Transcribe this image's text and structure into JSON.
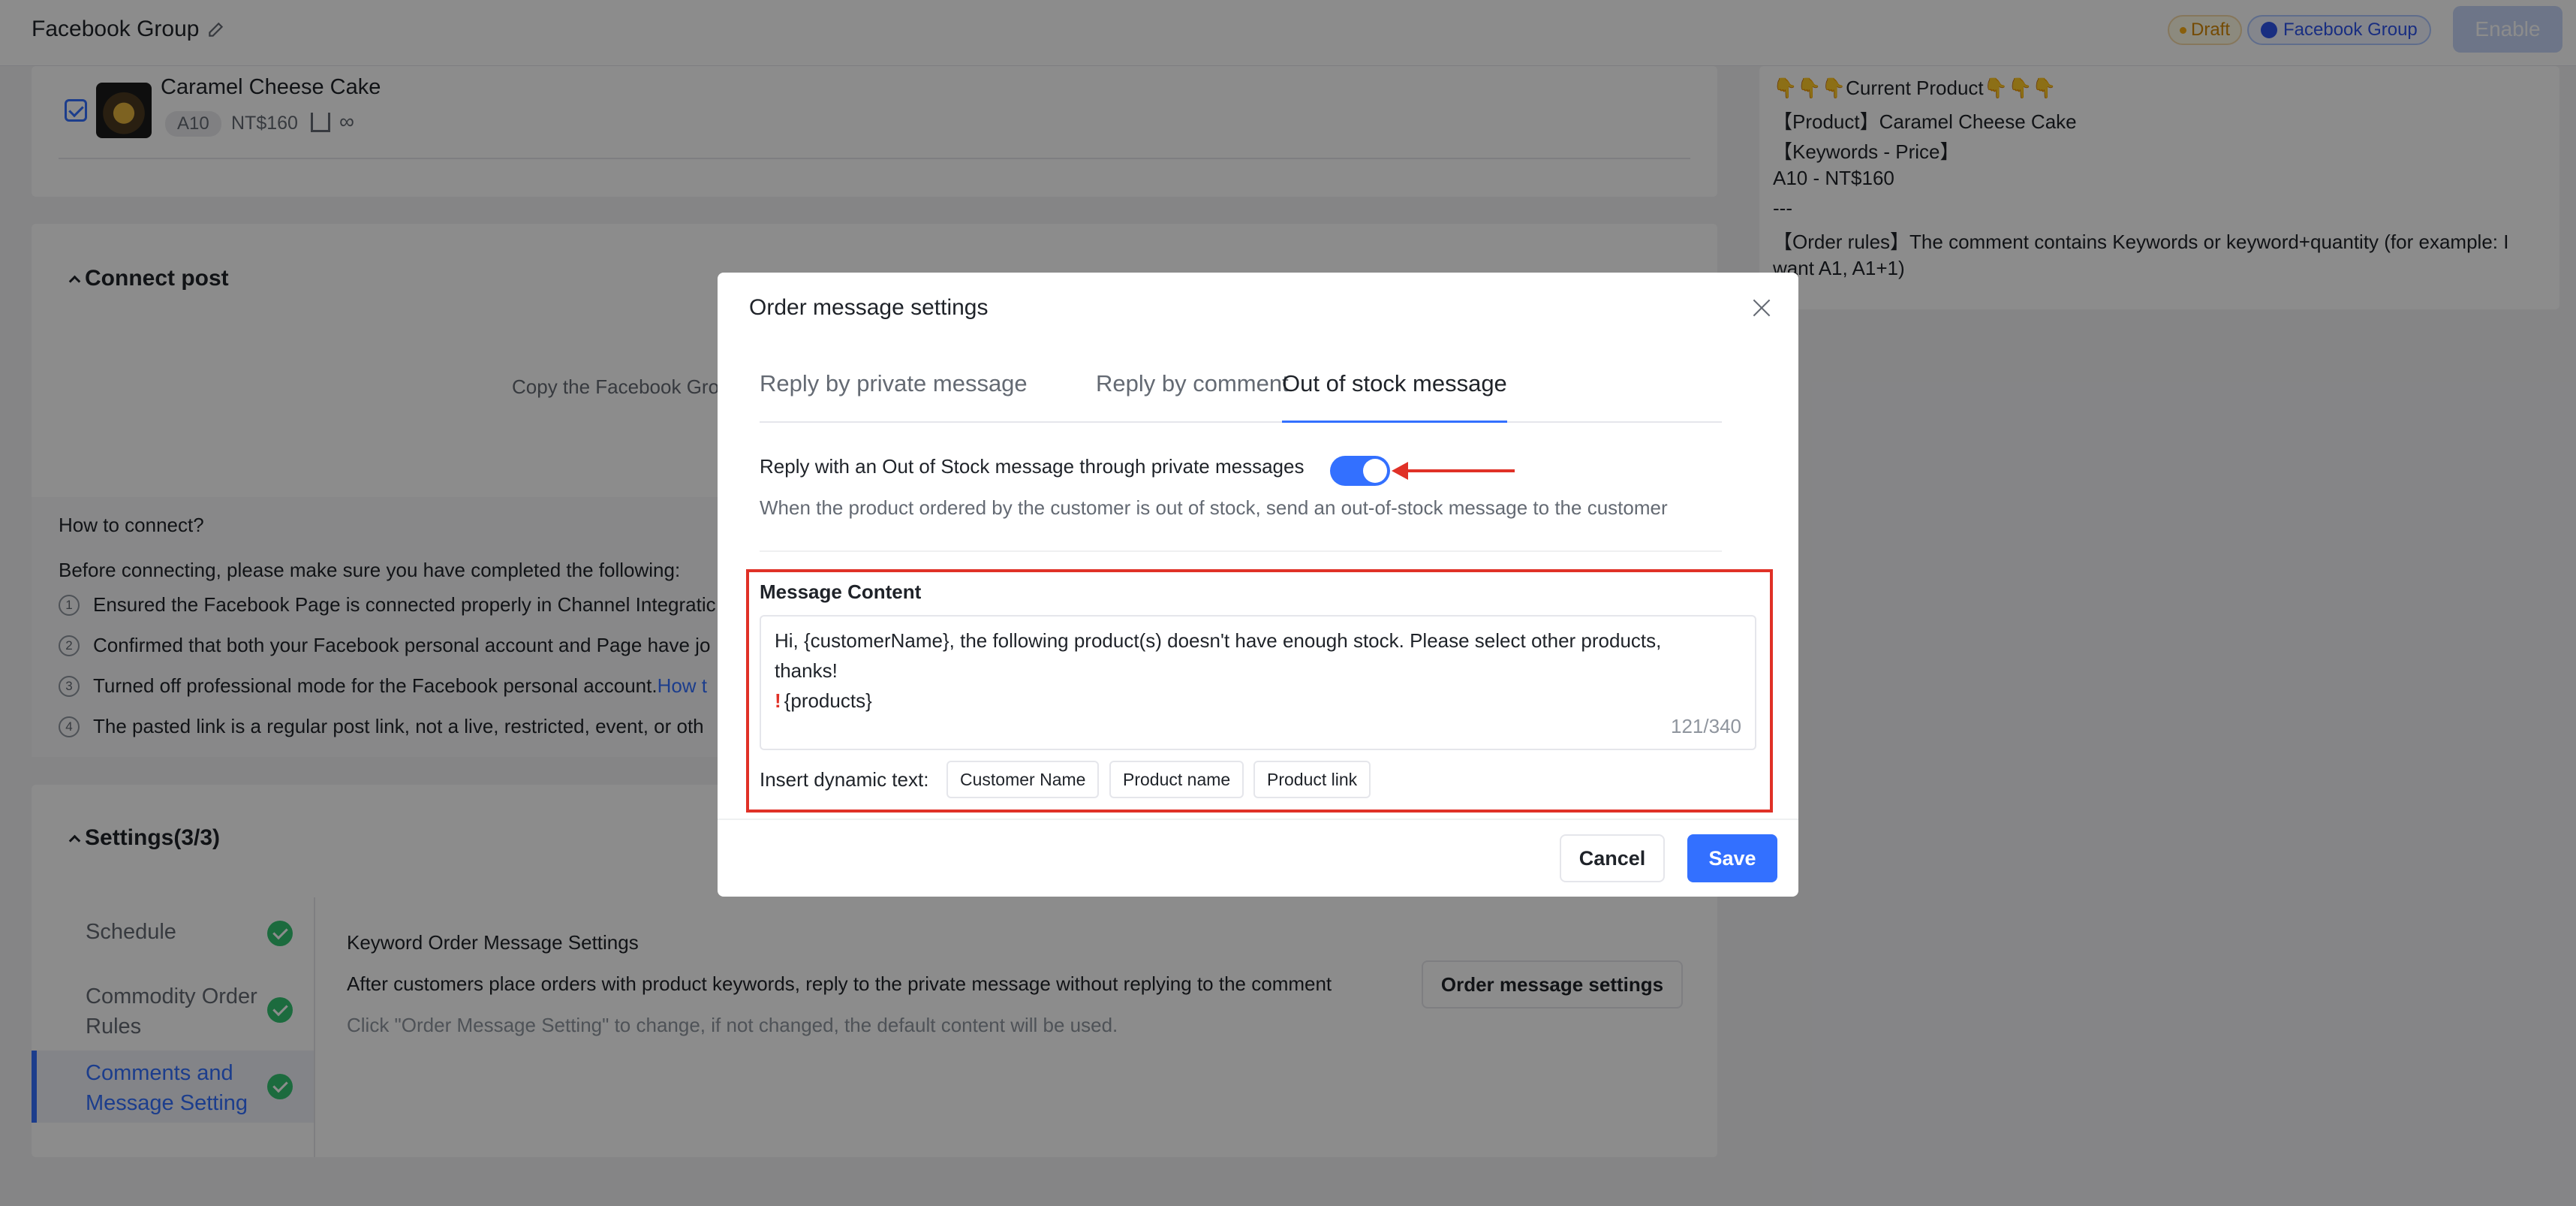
{
  "header": {
    "title": "Facebook Group",
    "edit_icon": "pencil-icon",
    "draft_badge": "Draft",
    "channel_badge": "Facebook Group",
    "enable_label": "Enable"
  },
  "product": {
    "name": "Caramel Cheese Cake",
    "keyword": "A10",
    "price": "NT$160",
    "stock": "∞"
  },
  "connect": {
    "title": "Connect post",
    "copy_hint": "Copy the Facebook Gro",
    "howto_title": "How to connect?",
    "before_text": "Before connecting, please make sure you have completed the following:",
    "steps": [
      {
        "num": "1",
        "text": "Ensured the Facebook Page is connected properly in Channel Integratic"
      },
      {
        "num": "2",
        "text": "Confirmed that both your Facebook personal account and Page have jo"
      },
      {
        "num": "3",
        "text": "Turned off professional mode for the Facebook personal account.",
        "link": "How t"
      },
      {
        "num": "4",
        "text": "The pasted link is a regular post link, not a live, restricted, event, or oth"
      }
    ]
  },
  "settings": {
    "title": "Settings(3/3)",
    "nav": [
      {
        "label": "Schedule"
      },
      {
        "label_1": "Commodity Order",
        "label_2": "Rules"
      },
      {
        "label_1": "Comments and",
        "label_2": "Message Setting"
      }
    ],
    "kw_title": "Keyword Order Message Settings",
    "kw_desc": "After customers place orders with product keywords, reply to the private message without replying to the comment",
    "kw_note": "Click \"Order Message Setting\" to change, if not changed, the default content will be used.",
    "oms_button": "Order message settings"
  },
  "preview": {
    "lines": [
      "👇👇👇Current Product👇👇👇",
      "【Product】Caramel Cheese Cake",
      "【Keywords - Price】",
      "A10 - NT$160",
      "---",
      "【Order rules】The comment contains Keywords or keyword+quantity (for example: I",
      "want A1, A1+1)"
    ]
  },
  "modal": {
    "title": "Order message settings",
    "tabs": [
      "Reply by private message",
      "Reply by comment",
      "Out of stock message"
    ],
    "active_tab": 2,
    "toggle_label": "Reply with an Out of Stock message through private messages",
    "toggle_on": true,
    "toggle_desc": "When the product ordered by the customer is out of stock, send an out-of-stock message to the customer",
    "message_label": "Message Content",
    "message_lines": [
      "Hi, {customerName}, the following product(s) doesn't have enough stock. Please select other products,",
      "thanks!",
      "{products}"
    ],
    "excl": "!",
    "counter": "121/340",
    "insert_label": "Insert dynamic text:",
    "chips": [
      "Customer Name",
      "Product name",
      "Product link"
    ],
    "cancel_label": "Cancel",
    "save_label": "Save"
  },
  "colors": {
    "accent": "#3370ff",
    "highlight_red": "#e03127",
    "success": "#34c471"
  }
}
